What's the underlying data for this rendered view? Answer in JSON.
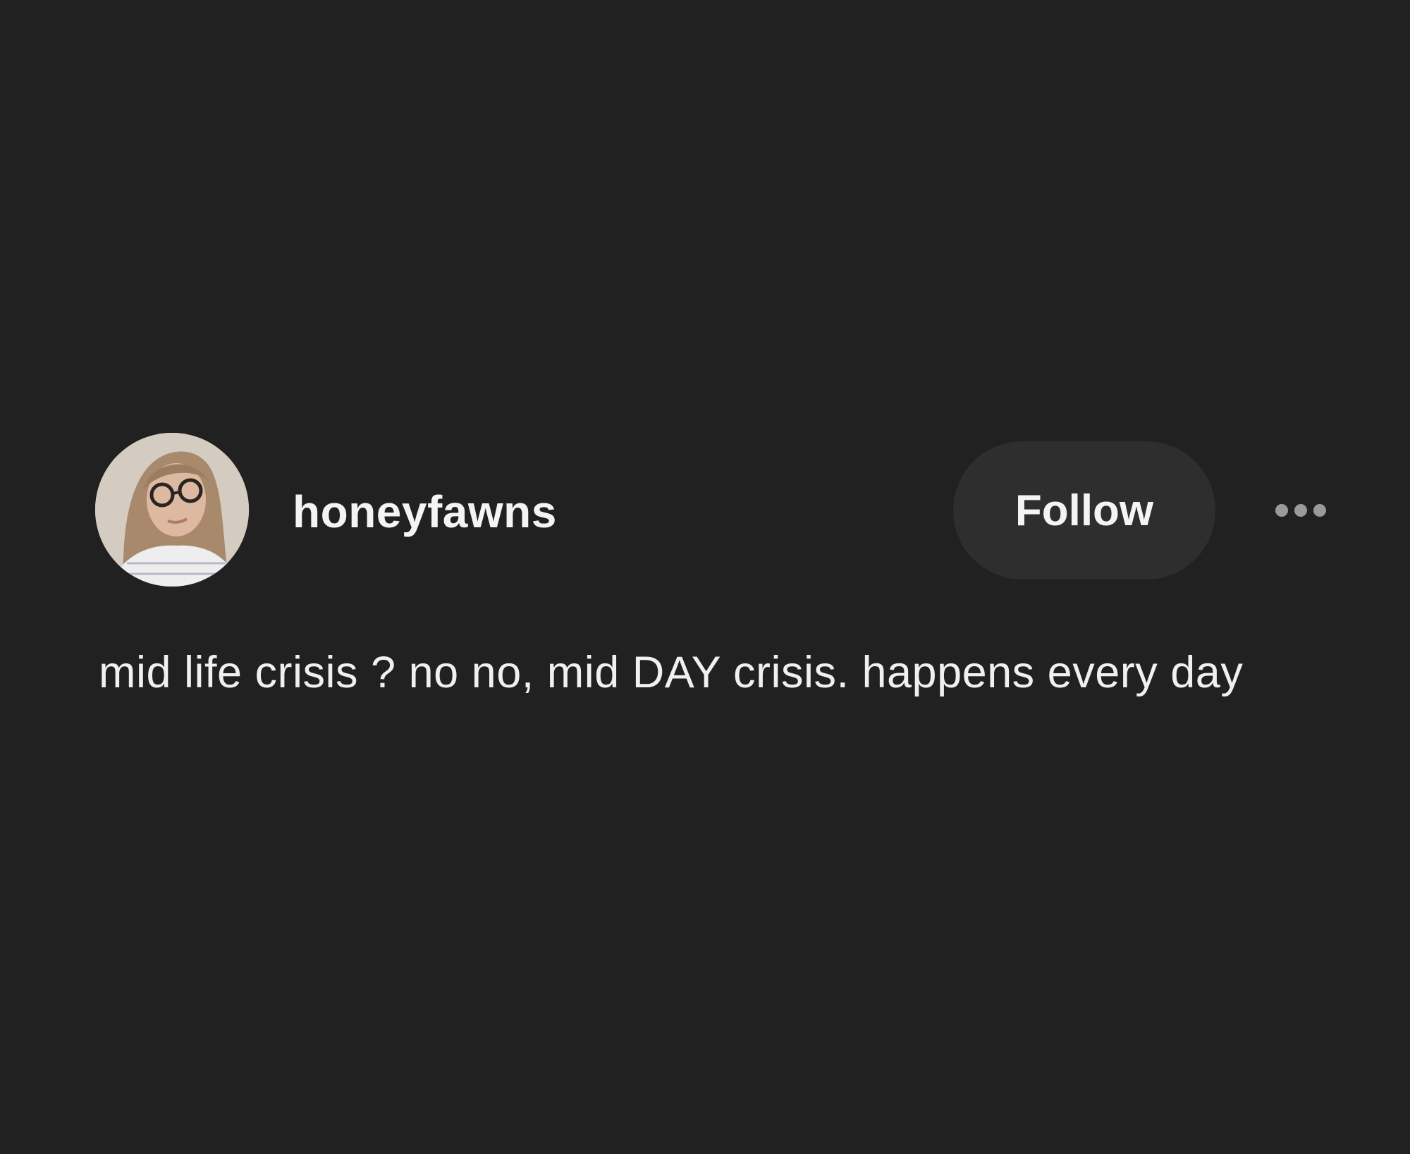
{
  "post": {
    "author": {
      "username": "honeyfawns",
      "avatar_icon": "profile-photo"
    },
    "follow_label": "Follow",
    "more_icon": "more-options-icon",
    "text": "mid life crisis ? no no, mid DAY crisis. happens every day"
  },
  "colors": {
    "background": "#212121",
    "button_background": "#2e2e2e",
    "text": "#f2f2f2",
    "muted_icon": "#9a9a9a"
  }
}
